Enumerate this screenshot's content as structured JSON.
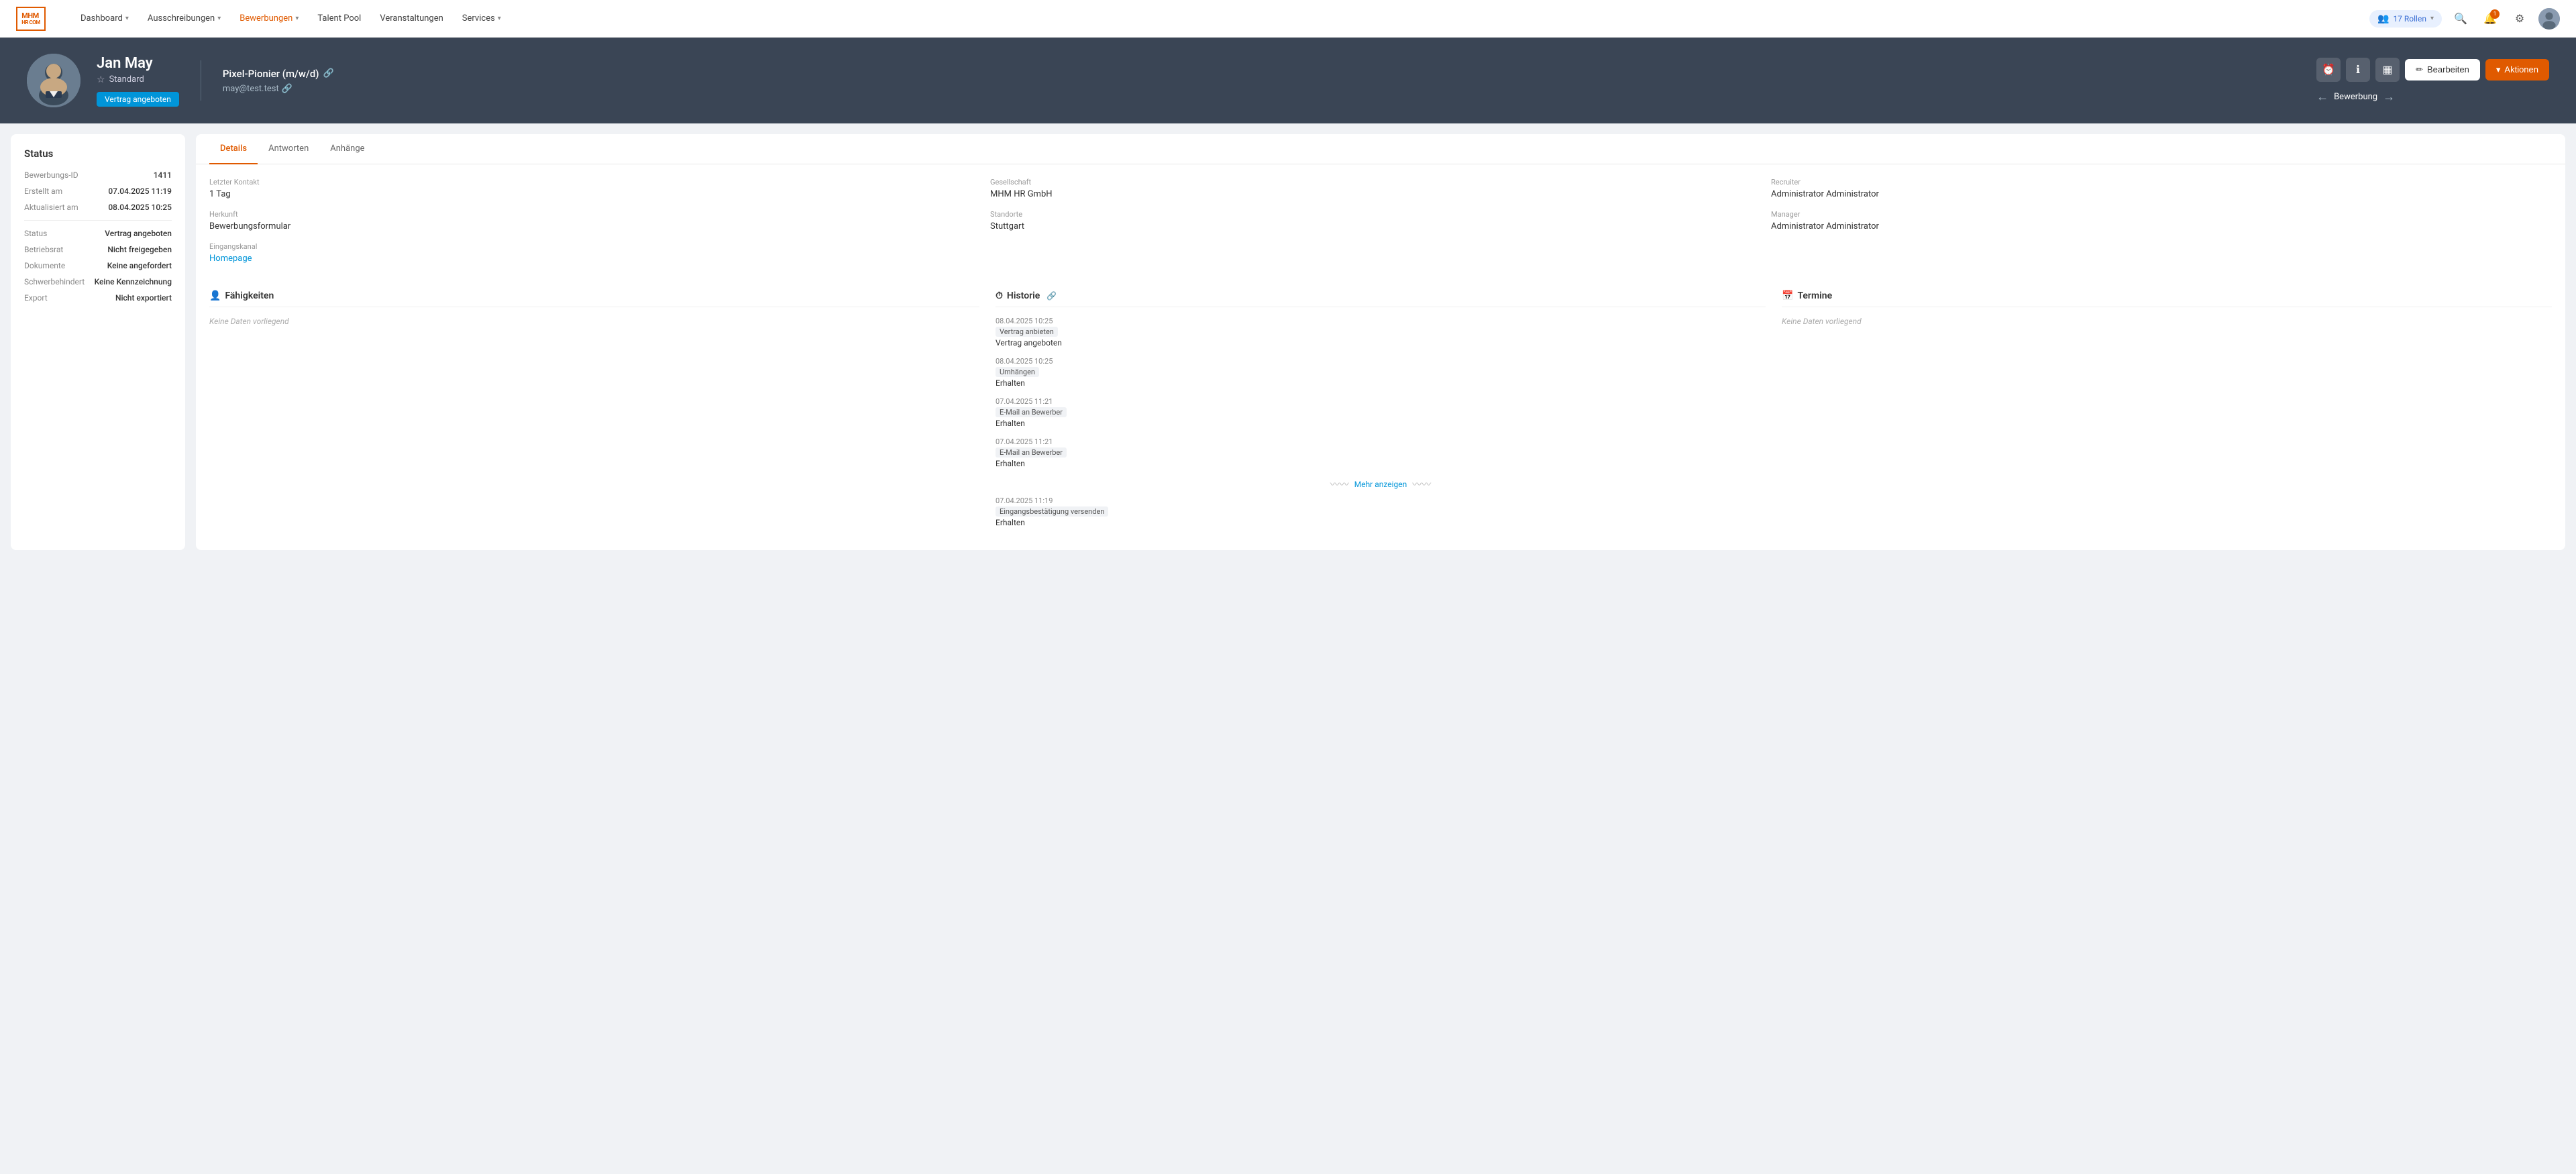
{
  "app": {
    "logo_line1": "MHM",
    "logo_line2": "HR COM"
  },
  "navbar": {
    "items": [
      {
        "label": "Dashboard",
        "has_chevron": true
      },
      {
        "label": "Ausschreibungen",
        "has_chevron": true
      },
      {
        "label": "Bewerbungen",
        "has_chevron": true,
        "active": true
      },
      {
        "label": "Talent Pool",
        "has_chevron": false
      },
      {
        "label": "Veranstaltungen",
        "has_chevron": false
      },
      {
        "label": "Services",
        "has_chevron": true
      }
    ],
    "roles_label": "17 Rollen",
    "notification_count": "1"
  },
  "hero": {
    "name": "Jan May",
    "rank": "Standard",
    "badge": "Vertrag angeboten",
    "job_title": "Pixel-Pionier (m/w/d)",
    "email": "may@test.test",
    "btn_edit": "Bearbeiten",
    "btn_action": "Aktionen",
    "nav_label": "Bewerbung",
    "icon_alarm": "⏰",
    "icon_info": "ℹ",
    "icon_grid": "▦"
  },
  "status": {
    "title": "Status",
    "fields": [
      {
        "label": "Bewerbungs-ID",
        "value": "1411"
      },
      {
        "label": "Erstellt am",
        "value": "07.04.2025 11:19"
      },
      {
        "label": "Aktualisiert am",
        "value": "08.04.2025 10:25"
      },
      {
        "label": "Status",
        "value": "Vertrag angeboten"
      },
      {
        "label": "Betriebsrat",
        "value": "Nicht freigegeben"
      },
      {
        "label": "Dokumente",
        "value": "Keine angefordert"
      },
      {
        "label": "Schwerbehindert",
        "value": "Keine Kennzeichnung"
      },
      {
        "label": "Export",
        "value": "Nicht exportiert"
      }
    ]
  },
  "tabs": [
    {
      "label": "Details",
      "active": true
    },
    {
      "label": "Antworten"
    },
    {
      "label": "Anhänge"
    }
  ],
  "details": {
    "col1": [
      {
        "label": "Letzter Kontakt",
        "value": "1 Tag"
      },
      {
        "label": "Herkunft",
        "value": "Bewerbungsformular"
      },
      {
        "label": "Eingangskanal",
        "value": "Homepage",
        "is_link": true
      }
    ],
    "col2": [
      {
        "label": "Gesellschaft",
        "value": "MHM HR GmbH"
      },
      {
        "label": "Standorte",
        "value": "Stuttgart"
      }
    ],
    "col3": [
      {
        "label": "Recruiter",
        "value": "Administrator Administrator"
      },
      {
        "label": "Manager",
        "value": "Administrator Administrator"
      }
    ]
  },
  "sections": {
    "faehigkeiten": {
      "title": "Fähigkeiten",
      "icon": "👤",
      "empty_text": "Keine Daten vorliegend"
    },
    "historie": {
      "title": "Historie",
      "icon": "⏱",
      "entries": [
        {
          "date": "08.04.2025 10:25",
          "action": "Vertrag anbieten",
          "status": "Vertrag angeboten"
        },
        {
          "date": "08.04.2025 10:25",
          "action": "Umhängen",
          "status": "Erhalten"
        },
        {
          "date": "07.04.2025 11:21",
          "action": "E-Mail an Bewerber",
          "status": "Erhalten"
        },
        {
          "date": "07.04.2025 11:21",
          "action": "E-Mail an Bewerber",
          "status": "Erhalten"
        }
      ],
      "mehr_anzeigen": "Mehr anzeigen",
      "extra_entry": {
        "date": "07.04.2025 11:19",
        "action": "Eingangsbestätigung versenden",
        "status": "Erhalten"
      }
    },
    "termine": {
      "title": "Termine",
      "icon": "📅",
      "empty_text": "Keine Daten vorliegend"
    }
  }
}
